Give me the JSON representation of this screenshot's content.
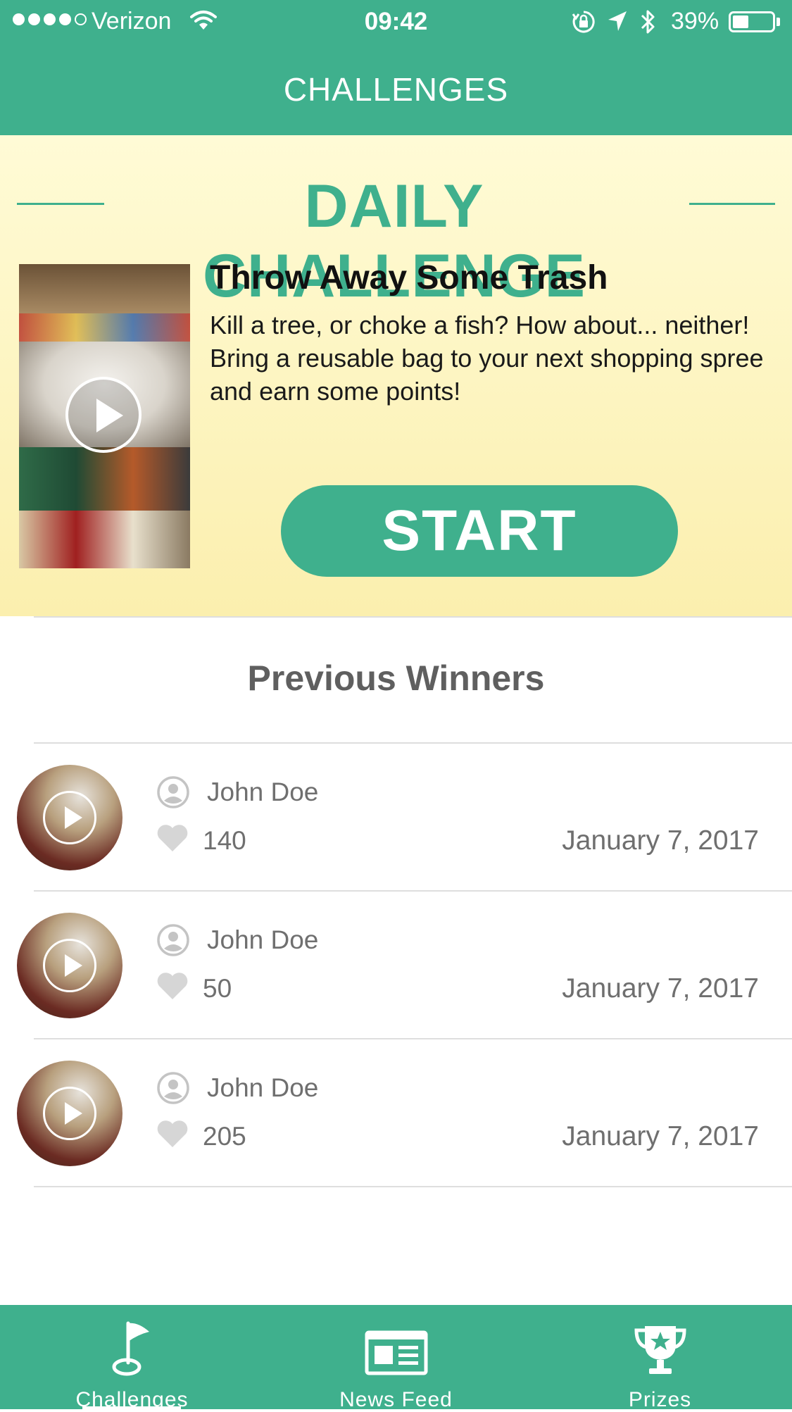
{
  "status_bar": {
    "carrier": "Verizon",
    "time": "09:42",
    "battery": "39%",
    "signal_icon": "signal-dots-icon",
    "wifi_icon": "wifi-icon",
    "lock_icon": "rotation-lock-icon",
    "location_icon": "location-arrow-icon",
    "bluetooth_icon": "bluetooth-icon",
    "battery_level": 0.39
  },
  "nav": {
    "title": "CHALLENGES"
  },
  "daily_challenge": {
    "header": "DAILY CHALLENGE",
    "title": "Throw Away Some Trash",
    "description": "Kill a tree, or choke a fish? How about... neither! Bring a reusable bag to your next shopping spree and earn some points!",
    "start_label": "START",
    "thumbnail_icon": "play-icon"
  },
  "previous_winners": {
    "title": "Previous Winners",
    "items": [
      {
        "name": "John Doe",
        "likes": "140",
        "date": "January 7, 2017"
      },
      {
        "name": "John Doe",
        "likes": "50",
        "date": "January 7, 2017"
      },
      {
        "name": "John Doe",
        "likes": "205",
        "date": "January 7, 2017"
      }
    ]
  },
  "tabs": [
    {
      "label": "Challenges",
      "icon": "flag-golf-icon",
      "active": true
    },
    {
      "label": "News Feed",
      "icon": "newspaper-icon",
      "active": false
    },
    {
      "label": "Prizes",
      "icon": "trophy-icon",
      "active": false
    }
  ],
  "colors": {
    "accent": "#3fb08d",
    "banner_top": "#fffbd6",
    "banner_bottom": "#fbefae",
    "text_muted": "#6f6f6f"
  }
}
